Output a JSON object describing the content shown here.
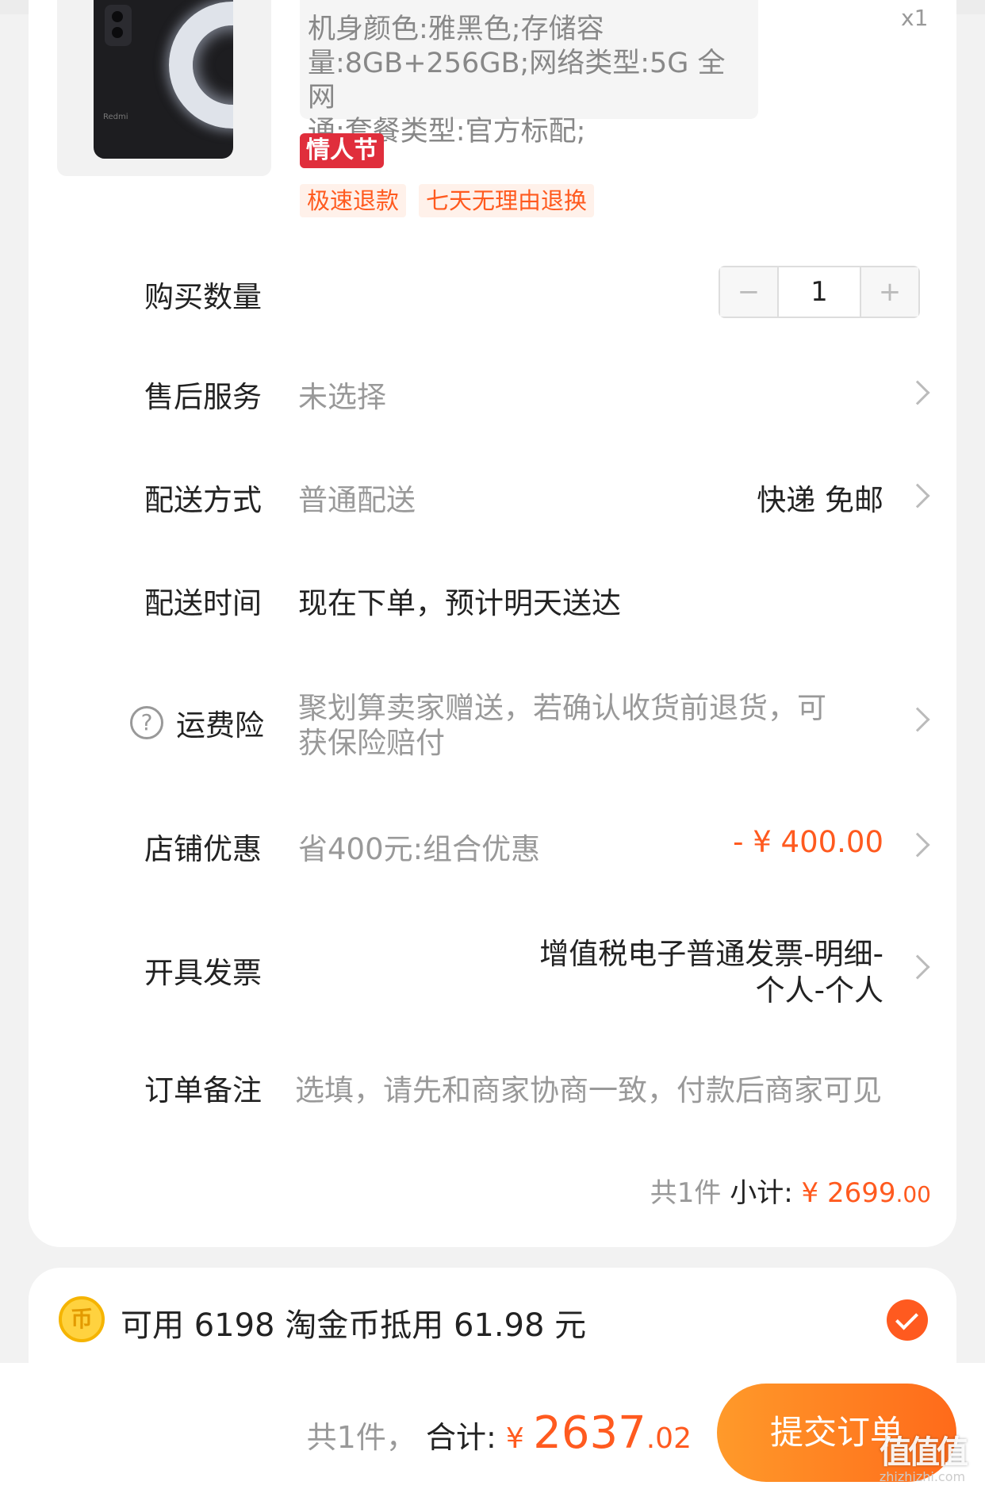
{
  "product": {
    "spec_lines": [
      "机身颜色:雅黑色;存储容",
      "量:8GB+256GB;网络类型:5G 全网",
      "通;套餐类型:官方标配;"
    ],
    "quantity_tag": "x1",
    "festival_tag": "情人节",
    "service_tags": [
      "极速退款",
      "七天无理由退换"
    ],
    "brand_mark": "Redmi"
  },
  "quantity": {
    "label": "购买数量",
    "minus": "−",
    "value": "1",
    "plus": "+"
  },
  "after_sales": {
    "label": "售后服务",
    "value": "未选择"
  },
  "delivery_method": {
    "label": "配送方式",
    "value": "普通配送",
    "right": "快递 免邮"
  },
  "delivery_time": {
    "label": "配送时间",
    "value": "现在下单，预计明天送达"
  },
  "shipping_insurance": {
    "label": "运费险",
    "icon": "?",
    "value_line1": "聚划算卖家赠送，若确认收货前退货，可",
    "value_line2": "获保险赔付"
  },
  "store_discount": {
    "label": "店铺优惠",
    "value": "省400元:组合优惠",
    "amount": "- ¥ 400.00"
  },
  "invoice": {
    "label": "开具发票",
    "line1": "增值税电子普通发票-明细-",
    "line2": "个人-个人"
  },
  "order_note": {
    "label": "订单备注",
    "placeholder": "选填，请先和商家协商一致，付款后商家可见"
  },
  "subtotal": {
    "count": "共1件",
    "label": "小计:",
    "currency": "¥",
    "integer": "2699",
    "decimal": ".00"
  },
  "coins": {
    "icon": "币",
    "text": "可用 6198 淘金币抵用 61.98 元",
    "checked": true
  },
  "footer": {
    "count": "共1件，",
    "label": "合计:",
    "currency": "¥ ",
    "integer": "2637",
    "decimal": ".02",
    "submit_label": "提交订单"
  },
  "watermark": {
    "logo": "值值值",
    "site": "zhizhizhi.com"
  },
  "colors": {
    "accent": "#ff5a1f",
    "festival": "#e02e3c",
    "coin": "#ffd23f"
  }
}
